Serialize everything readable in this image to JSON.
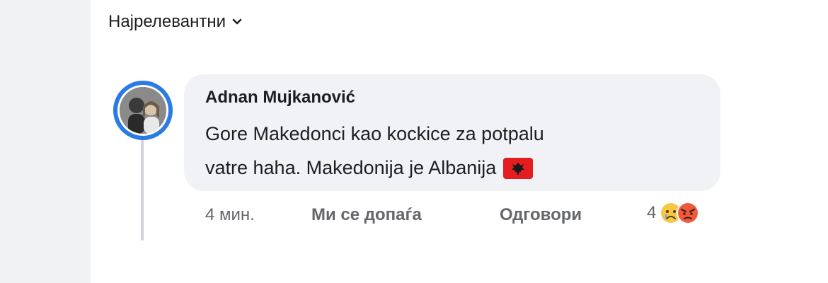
{
  "sort": {
    "label": "Најрелевантни"
  },
  "comment": {
    "author": "Adnan Mujkanović",
    "text_line1": "Gore Makedonci kao kockice za potpalu",
    "text_line2": "vatre haha. Makedonija je Albanija",
    "flag_icon": "albania-flag-icon",
    "time": "4 мин.",
    "like_label": "Ми се допаѓа",
    "reply_label": "Одговори",
    "reaction_count": "4",
    "reactions": [
      "sad-icon",
      "angry-icon"
    ]
  },
  "colors": {
    "avatar_ring": "#2b7be5",
    "bubble": "#f0f2f5",
    "meta_text": "#65676b"
  }
}
